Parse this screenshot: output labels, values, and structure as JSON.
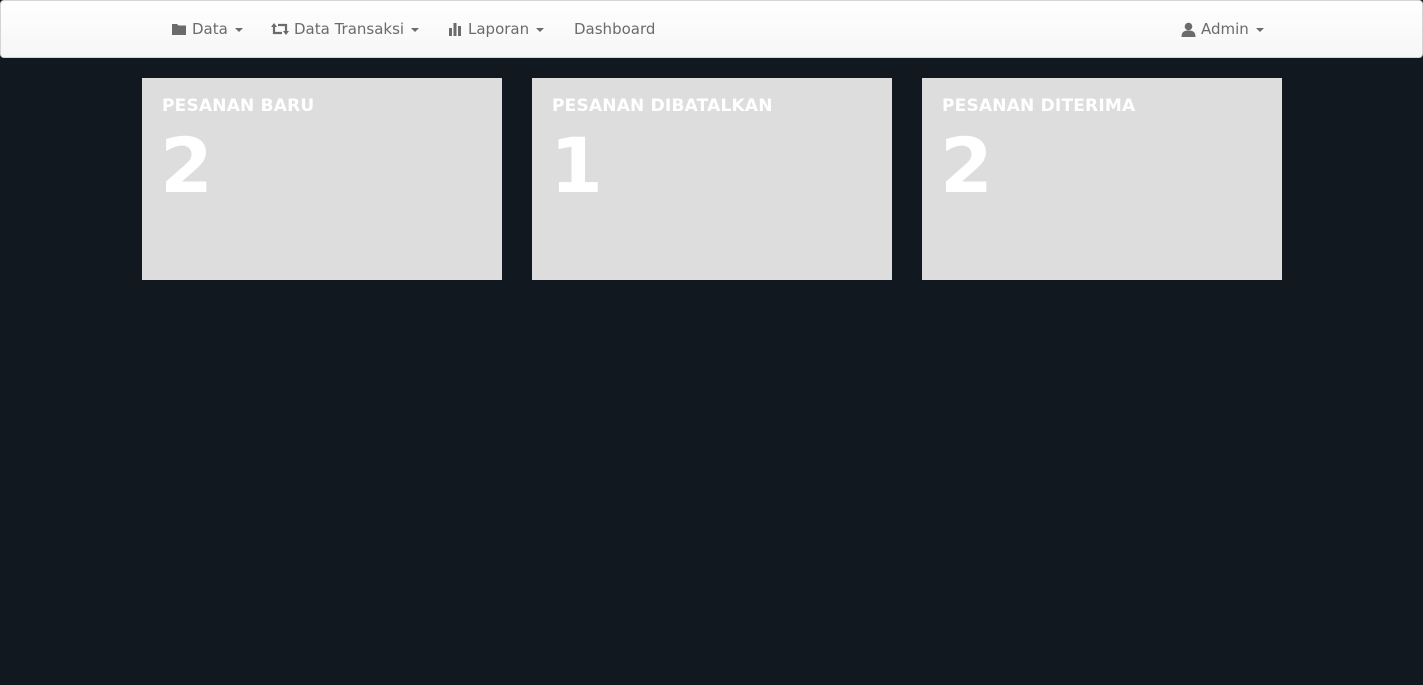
{
  "nav": {
    "data_label": "Data",
    "transaksi_label": "Data Transaksi",
    "laporan_label": "Laporan",
    "dashboard_label": "Dashboard",
    "user_label": "Admin"
  },
  "icons": {
    "data": "folder-icon",
    "transaksi": "retweet-icon",
    "laporan": "bar-chart-icon",
    "user": "user-icon"
  },
  "cards": [
    {
      "title": "PESANAN BARU",
      "value": "2"
    },
    {
      "title": "PESANAN DIBATALKAN",
      "value": "1"
    },
    {
      "title": "PESANAN DITERIMA",
      "value": "2"
    }
  ],
  "colors": {
    "background": "#121820",
    "card": "#dddddd",
    "navbar": "#f8f8f8",
    "nav_text": "#6b6b6b"
  }
}
